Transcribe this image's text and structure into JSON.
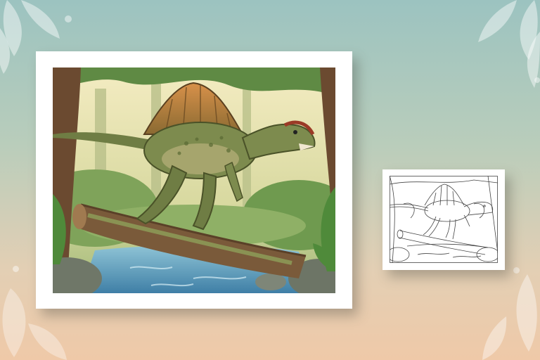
{
  "scene": {
    "background_top": "#9cc3c0",
    "background_bottom": "#efc9a8",
    "decor": [
      "leaf-branch-icon",
      "leaf-branch-icon",
      "leaf-branch-icon",
      "leaf-branch-icon"
    ]
  },
  "artwork_color": {
    "subject": "spinosaurus-on-log",
    "palette": {
      "sail": "#c07a3a",
      "body": "#7d8b4e",
      "water": "#5a9fc0",
      "log": "#7a5a3a",
      "sky": "#f2e6b8"
    }
  },
  "artwork_lineart": {
    "subject": "spinosaurus-on-log-outline",
    "stroke": "#444444"
  }
}
